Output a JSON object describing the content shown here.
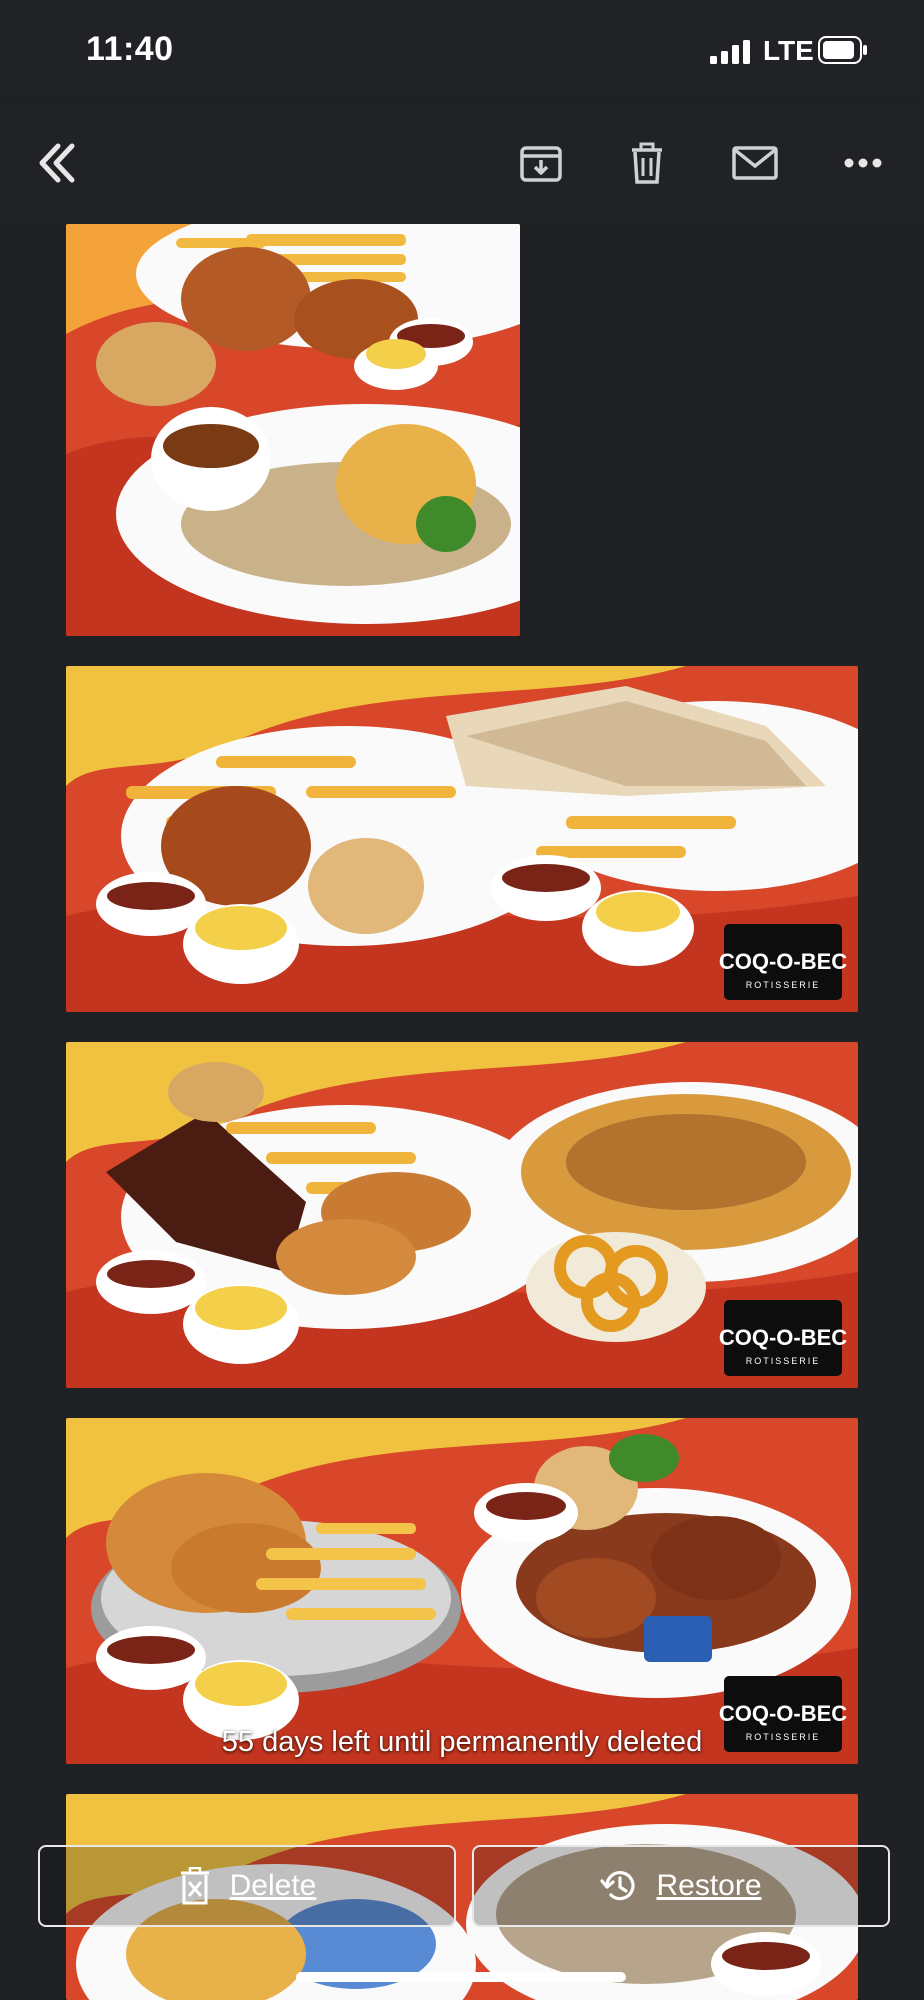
{
  "status_bar": {
    "time": "11:40",
    "carrier": "LTE"
  },
  "toolbar": {
    "icons": [
      "back-chevron-icon",
      "archive-icon",
      "trash-icon",
      "mail-icon",
      "more-icon"
    ]
  },
  "photos": [
    {
      "brand": "COQ-O-BEC",
      "brand_sub": "ROTISSERIE"
    },
    {
      "brand": "COQ-O-BEC",
      "brand_sub": "ROTISSERIE"
    },
    {
      "brand": "COQ-O-BEC",
      "brand_sub": "ROTISSERIE"
    },
    {
      "brand": "COQ-O-BEC",
      "brand_sub": "ROTISSERIE"
    }
  ],
  "notice": "55 days left until permanently deleted",
  "actions": {
    "delete_label": "Delete",
    "restore_label": "Restore"
  },
  "colors": {
    "background": "#1f2124",
    "bar": "#202225",
    "icon": "#cfd1d4",
    "poster_red": "#d9472a",
    "poster_yellow": "#f1c240"
  }
}
